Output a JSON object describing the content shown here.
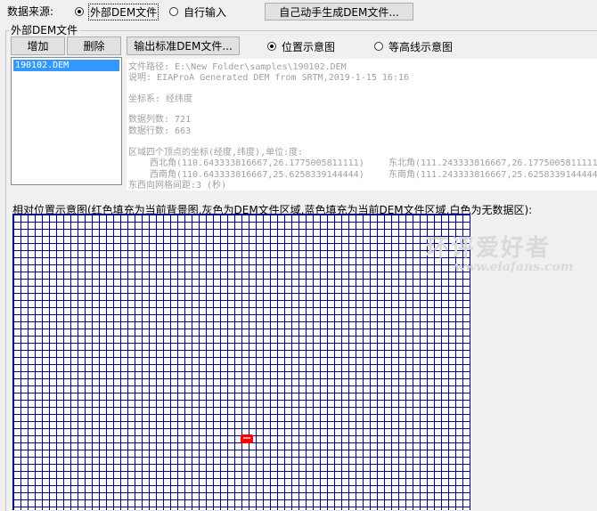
{
  "source": {
    "label": "数据来源:",
    "options": [
      {
        "label": "外部DEM文件",
        "checked": true
      },
      {
        "label": "自行输入",
        "checked": false
      }
    ],
    "generate_button": "自己动手生成DEM文件..."
  },
  "external_group": {
    "caption": "外部DEM文件",
    "add_button": "增加",
    "delete_button": "删除",
    "export_button": "输出标准DEM文件...",
    "view_options": [
      {
        "label": "位置示意图",
        "checked": true
      },
      {
        "label": "等高线示意图",
        "checked": false
      }
    ],
    "files": [
      "190102.DEM"
    ]
  },
  "info": {
    "path": "文件路径: E:\\New Folder\\samples\\190102.DEM",
    "description": "说明: EIAProA Generated DEM from SRTM,2019-1-15 16:16",
    "coord_system": "坐标系: 经纬度",
    "columns": "数据列数: 721",
    "rows": "数据行数: 663",
    "corners_title": "区域四个顶点的坐标(经度,纬度),单位:度:",
    "northwest": "西北角(110.643333816667,26.1775005811111)",
    "northeast": "东北角(111.243333816667,26.1775005811111)",
    "southwest": "西南角(110.643333816667,25.6258339144444)",
    "southeast": "东南角(111.243333816667,25.6258339144444)",
    "ew_spacing": "东西向网格间距:3 (秒)"
  },
  "position_map": {
    "caption": "相对位置示意图(红色填充为当前背景图,灰色为DEM文件区域,蓝色填充为当前DEM文件区域,白色为无数据区):",
    "grid_color": "#000080",
    "marker_color": "#ff0000"
  },
  "watermark": {
    "text": "环评爱好者",
    "url": "www.eiafans.com"
  }
}
